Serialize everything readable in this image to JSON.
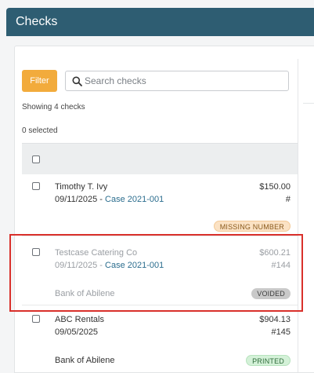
{
  "header": {
    "title": "Checks"
  },
  "toolbar": {
    "filter_label": "Filter",
    "search_placeholder": "Search checks"
  },
  "summary": {
    "showing": "Showing 4 checks",
    "selected": "0 selected"
  },
  "colors": {
    "header_bg": "#2e5d72",
    "filter_bg": "#f2ab3c",
    "case_link": "#2b6d8e",
    "highlight": "#d9302b"
  },
  "checks": [
    {
      "payee": "Timothy T. Ivy",
      "date": "09/11/2025",
      "separator": " - ",
      "case": "Case 2021-001",
      "amount": "$150.00",
      "number": "#",
      "bank": "",
      "status": "MISSING NUMBER"
    },
    {
      "payee": "Testcase Catering Co",
      "date": "09/11/2025",
      "separator": " - ",
      "case": "Case 2021-001",
      "amount": "$600.21",
      "number": "#144",
      "bank": "Bank of Abilene",
      "status": "VOIDED"
    },
    {
      "payee": "ABC Rentals",
      "date": "09/05/2025",
      "separator": "",
      "case": "",
      "amount": "$904.13",
      "number": "#145",
      "bank": "Bank of Abilene",
      "status": "PRINTED"
    }
  ]
}
